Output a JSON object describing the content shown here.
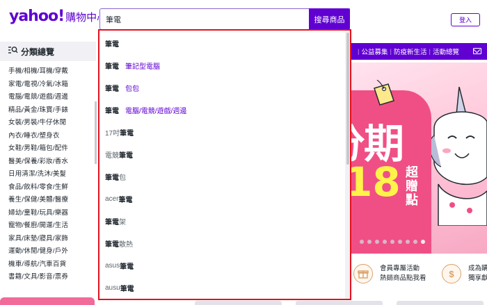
{
  "header": {
    "logo_yahoo": "yahoo!",
    "logo_shop": "購物中心",
    "search_value": "筆電",
    "search_button": "搜尋商品",
    "login_button": "登入"
  },
  "sidebar": {
    "title": "分類總覽",
    "categories": [
      "手機/相機/耳機/穿戴",
      "家電/電視/冷氣/冰箱",
      "電腦/電競/遊戲/週邊",
      "精品/黃金/珠寶/手錶",
      "女裝/男裝/牛仔休閒",
      "內衣/睡衣/塑身衣",
      "女鞋/男鞋/箱包/配件",
      "醫美/保養/彩妝/香水",
      "日用清潔/洗沐/美髮",
      "食品/飲料/零食/生鮮",
      "養生/保健/美體/醫療",
      "婦幼/童鞋/玩具/樂器",
      "寵物/餐廚/開運/生活",
      "家具/床墊/寢具/家飾",
      "運動/休閒/健身/戶外",
      "機車/導航/汽車百貨",
      "書籍/文具/影音/票券"
    ]
  },
  "topnav": {
    "items": [
      "公益募集",
      "防疫新生活",
      "活動總覽"
    ]
  },
  "banner": {
    "title_partial": "分期",
    "num_partial": "18",
    "sub": "超贈點"
  },
  "features": [
    {
      "icon_char": "🎁",
      "line1": "會員專屬活動",
      "line2": "熱銷商品點我看"
    },
    {
      "icon_char": "$",
      "line1": "成為購",
      "line2": "獨享獻"
    }
  ],
  "dropdown": {
    "suggestions": [
      {
        "bold": "筆電",
        "plain": "",
        "category": "",
        "plain_first": false
      },
      {
        "bold": "筆電",
        "plain": "",
        "category": "筆記型電腦",
        "plain_first": false
      },
      {
        "bold": "筆電",
        "plain": "",
        "category": "包包",
        "plain_first": false
      },
      {
        "bold": "筆電",
        "plain": "",
        "category": "電腦/電競/遊戲/週邊",
        "plain_first": false
      },
      {
        "bold": "筆電",
        "plain": "17吋",
        "category": "",
        "plain_first": true
      },
      {
        "bold": "筆電",
        "plain": "電競",
        "category": "",
        "plain_first": true
      },
      {
        "bold": "筆電",
        "plain": "包",
        "category": "",
        "plain_first": false
      },
      {
        "bold": "筆電",
        "plain": "acer ",
        "category": "",
        "plain_first": true
      },
      {
        "bold": "筆電",
        "plain": "架",
        "category": "",
        "plain_first": false
      },
      {
        "bold": "筆電",
        "plain": "散熱",
        "category": "",
        "plain_first": false
      },
      {
        "bold": "筆電",
        "plain": "asus",
        "category": "",
        "plain_first": true
      },
      {
        "bold": "筆電",
        "plain": "ausu",
        "category": "",
        "plain_first": true
      }
    ]
  },
  "colors": {
    "brand_purple": "#6001d2",
    "highlight_red": "#e5101d",
    "banner_pink": "#f04f86",
    "banner_yellow": "#fff34a"
  }
}
